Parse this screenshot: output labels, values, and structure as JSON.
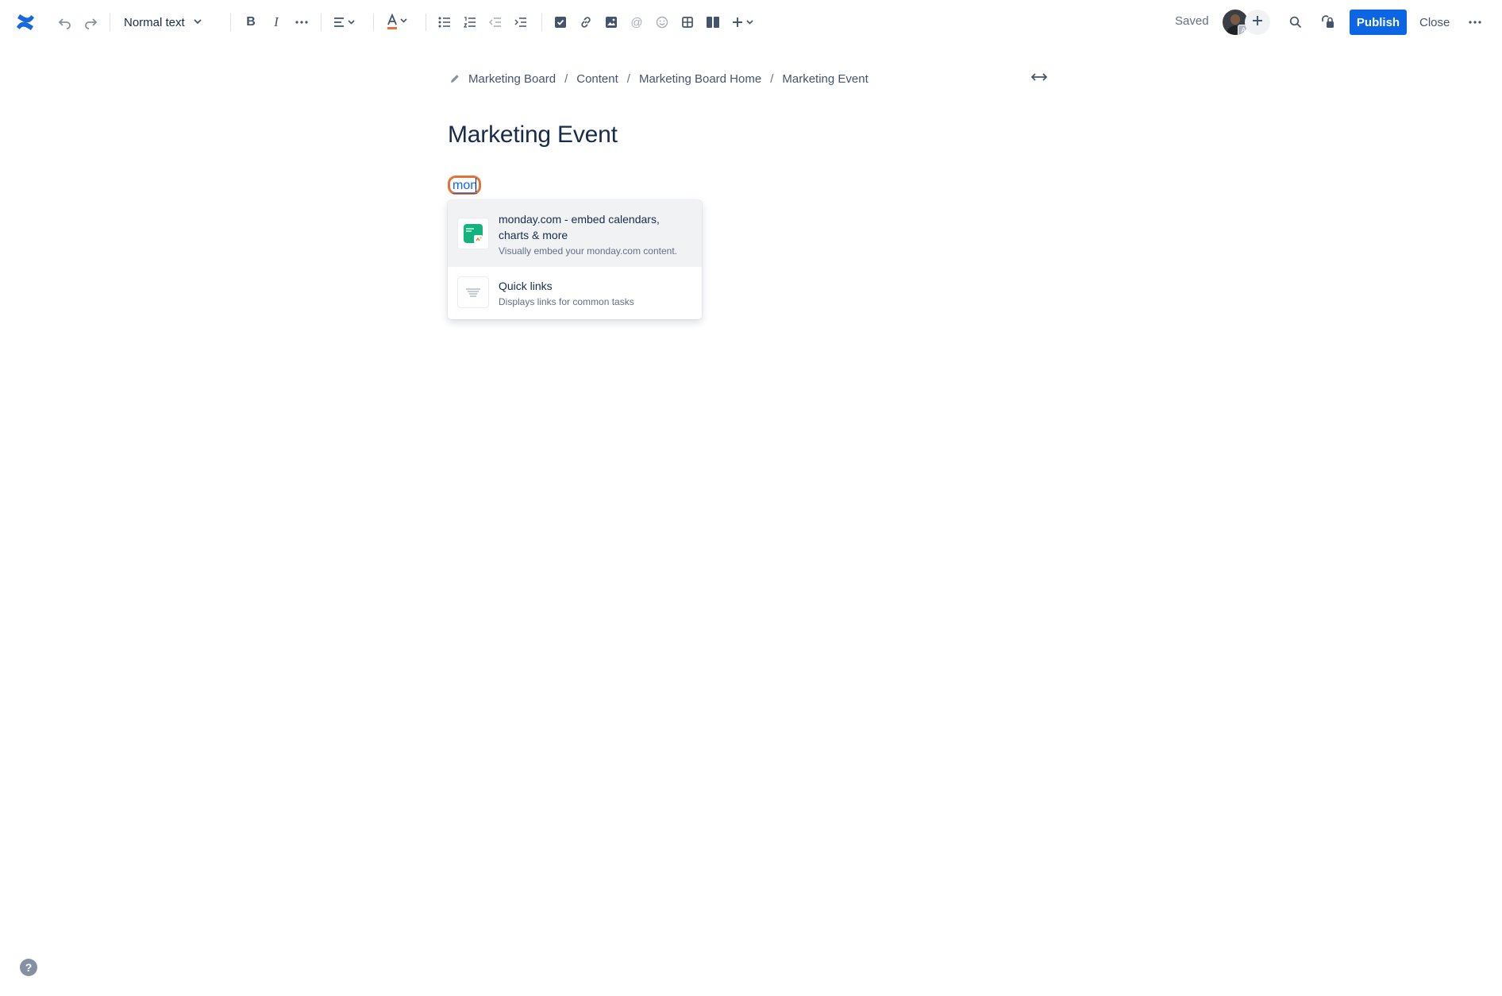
{
  "toolbar": {
    "text_style": "Normal text",
    "saved": "Saved",
    "publish": "Publish",
    "close": "Close",
    "avatar_badge": "A"
  },
  "breadcrumb": {
    "items": [
      "Marketing Board",
      "Content",
      "Marketing Board Home",
      "Marketing Event"
    ]
  },
  "page": {
    "title": "Marketing Event",
    "typed_query": "mon"
  },
  "menu": {
    "items": [
      {
        "title": "monday.com - embed calendars, charts & more",
        "description": "Visually embed your monday.com content."
      },
      {
        "title": "Quick links",
        "description": "Displays links for common tasks"
      }
    ]
  },
  "colors": {
    "accent": "#0c66e4",
    "highlight": "#e2733b",
    "logo": "#1868db",
    "monday_green": "#14b37d"
  },
  "help": {
    "label": "?"
  }
}
